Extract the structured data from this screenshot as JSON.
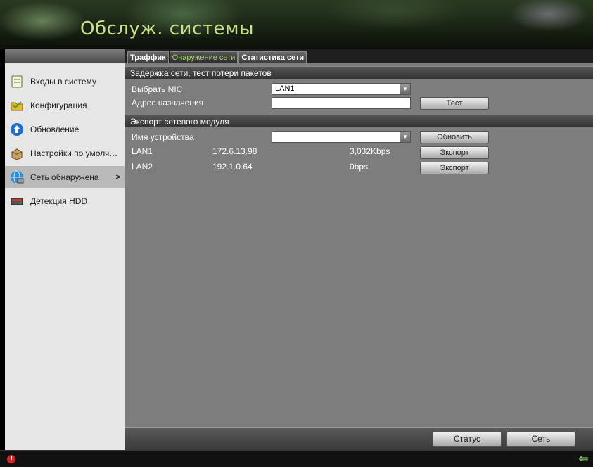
{
  "header": {
    "title": "Обслуж. системы"
  },
  "sidebar": {
    "items": [
      {
        "label": "Входы в систему",
        "icon": "log-icon"
      },
      {
        "label": "Конфигурация",
        "icon": "folder-icon"
      },
      {
        "label": "Обновление",
        "icon": "upgrade-icon"
      },
      {
        "label": "Настройки по умолчан...",
        "icon": "default-box-icon"
      },
      {
        "label": "Сеть обнаружена",
        "icon": "network-globe-icon",
        "active": true,
        "arrow": ">"
      },
      {
        "label": "Детекция HDD",
        "icon": "hdd-icon"
      }
    ]
  },
  "tabs": [
    {
      "label": "Траффик"
    },
    {
      "label": "Онаружение сети",
      "active": true
    },
    {
      "label": "Статистика сети"
    }
  ],
  "section1": {
    "title": "Задержка сети, тест потери пакетов",
    "nic_label": "Выбрать NIC",
    "nic_value": "LAN1",
    "dest_label": "Адрес назначения",
    "dest_value": "",
    "test_button": "Тест"
  },
  "section2": {
    "title": "Экспорт сетевого модуля",
    "device_label": "Имя устройства",
    "device_value": "",
    "refresh_button": "Обновить",
    "rows": [
      {
        "name": "LAN1",
        "ip": "172.6.13.98",
        "rate": "3,032Kbps",
        "button": "Экспорт"
      },
      {
        "name": "LAN2",
        "ip": "192.1.0.64",
        "rate": "0bps",
        "button": "Экспорт"
      }
    ]
  },
  "bottom": {
    "status_button": "Статус",
    "network_button": "Сеть"
  },
  "colors": {
    "accent": "#a7d26a",
    "title": "#c7e08a",
    "panel": "#7d7d7d",
    "sidebar": "#e6e6e6"
  }
}
